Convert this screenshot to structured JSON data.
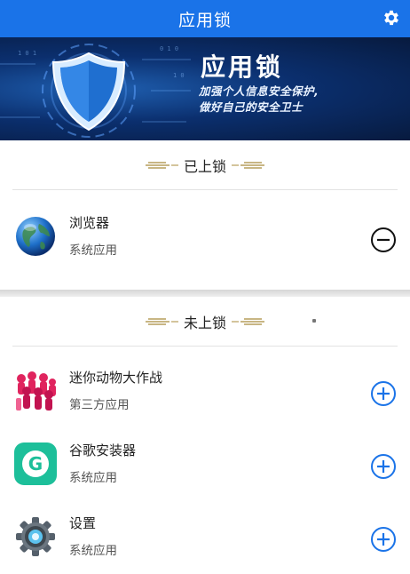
{
  "header": {
    "title": "应用锁"
  },
  "banner": {
    "title": "应用锁",
    "line1": "加强个人信息安全保护,",
    "line2": "做好自己的安全卫士"
  },
  "locked_section": {
    "title": "已上锁",
    "items": [
      {
        "name": "浏览器",
        "type": "系统应用",
        "icon": "globe-icon",
        "action": "remove"
      }
    ]
  },
  "unlocked_section": {
    "title": "未上锁",
    "items": [
      {
        "name": "迷你动物大作战",
        "type": "第三方应用",
        "icon": "game-icon",
        "action": "add"
      },
      {
        "name": "谷歌安装器",
        "type": "系统应用",
        "icon": "google-installer-icon",
        "action": "add"
      },
      {
        "name": "设置",
        "type": "系统应用",
        "icon": "settings-gear-icon",
        "action": "add"
      }
    ]
  },
  "colors": {
    "header_bg": "#1a73e8",
    "accent_blue": "#1a73e8",
    "remove_icon": "#111111"
  }
}
